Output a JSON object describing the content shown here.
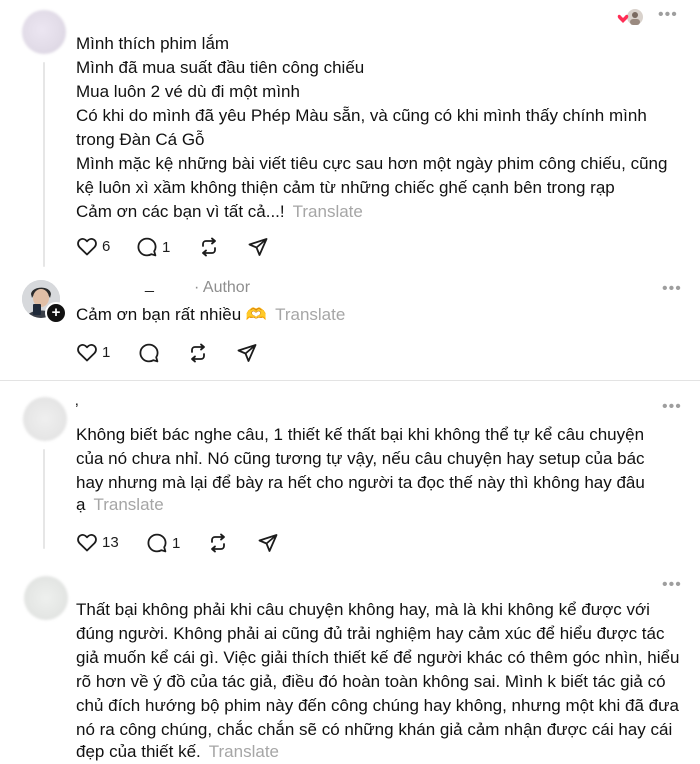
{
  "post1": {
    "lines": [
      "Mình thích phim lắm",
      "Mình đã mua suất đầu tiên công chiếu",
      "Mua luôn 2 vé dù đi một mình",
      "Có khi do mình đã yêu Phép Màu sẵn, và cũng có khi mình thấy chính mình",
      "trong Đàn Cá Gỗ",
      "Mình mặc kệ những bài viết tiêu cực sau hơn một ngày phim công chiếu, cũng",
      "kệ luôn xì xầm không thiện cảm từ những chiếc ghế cạnh bên trong rạp",
      "Cảm ơn các bạn vì tất cả...!"
    ],
    "translate": "Translate",
    "like_count": "6",
    "reply_count": "1"
  },
  "reply1": {
    "username": "_",
    "author_label": "· Author",
    "text": "Cảm ơn bạn rất nhiều 🫶",
    "translate": "Translate",
    "like_count": "1"
  },
  "post2": {
    "username": "‚",
    "lines": [
      "Không biết bác nghe câu, 1 thiết kế thất bại khi không thể tự kể câu chuyện",
      "của nó chưa nhỉ. Nó cũng tương tự vậy, nếu câu chuyện hay setup của bác",
      "hay nhưng mà lại để bày ra hết cho người ta đọc thế này thì không hay đâu",
      "ạ"
    ],
    "translate": "Translate",
    "like_count": "13",
    "reply_count": "1"
  },
  "reply2": {
    "lines": [
      "Thất bại không phải khi câu chuyện không hay, mà là khi không kể được với",
      "đúng người. Không phải ai cũng đủ trải nghiệm hay cảm xúc để hiểu được tác",
      "giả muốn kể cái gì. Việc giải thích thiết kế để người khác có thêm góc nhìn, hiểu",
      "rõ hơn về ý đồ của tác giả, điều đó hoàn toàn không sai. Mình k biết tác giả có",
      "chủ đích hướng bộ phim này đến công chúng hay không, nhưng một khi đã đưa",
      "nó ra công chúng, chắc chắn sẽ có những khán giả cảm nhận được cái hay cái",
      "đẹp của thiết kế."
    ],
    "translate": "Translate"
  },
  "colors": {
    "heart_red": "#ff2d55",
    "secondary_text": "#a6a6a6",
    "divider": "#e3e3e3"
  }
}
